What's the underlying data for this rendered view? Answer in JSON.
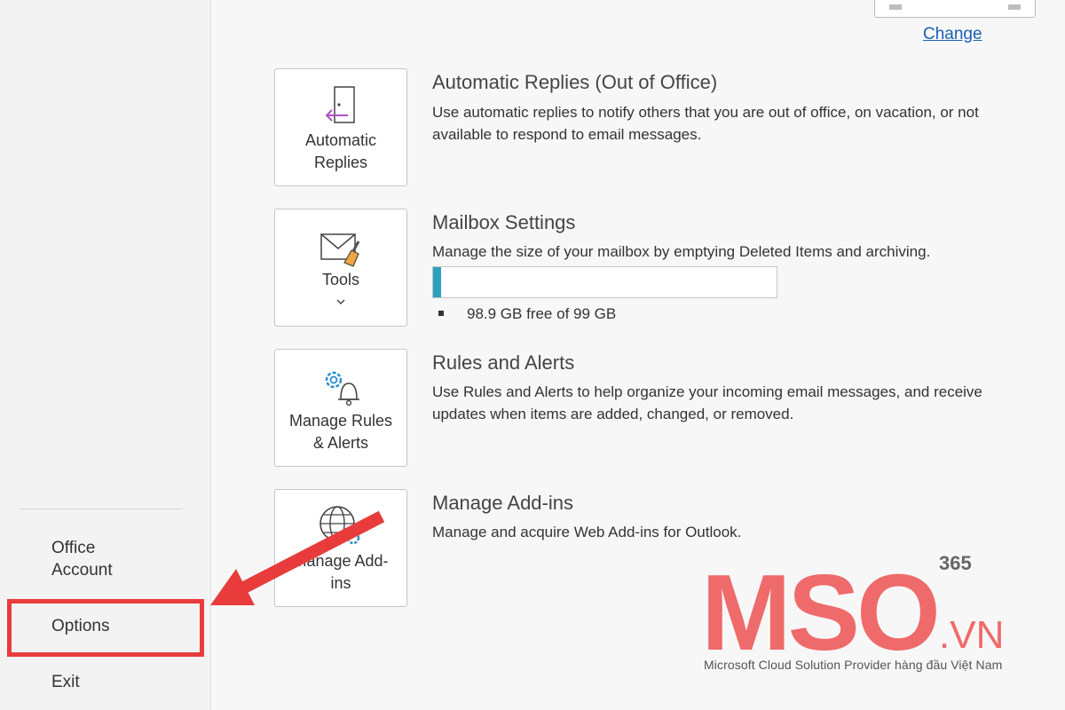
{
  "sidebar": {
    "items": [
      {
        "label": "Office Account"
      },
      {
        "label": "Options"
      },
      {
        "label": "Exit"
      }
    ]
  },
  "account": {
    "change_label": "Change"
  },
  "sections": [
    {
      "tile_label": "Automatic Replies",
      "tile_icon": "door-arrow-icon",
      "title": "Automatic Replies (Out of Office)",
      "description": "Use automatic replies to notify others that you are out of office, on vacation, or not available to respond to email messages."
    },
    {
      "tile_label": "Tools",
      "tile_icon": "mailbox-cleanup-icon",
      "title": "Mailbox Settings",
      "description": "Manage the size of your mailbox by emptying Deleted Items and archiving.",
      "storage_text": "98.9 GB free of 99 GB",
      "usage_fraction": 0.001
    },
    {
      "tile_label": "Manage Rules & Alerts",
      "tile_icon": "gear-bell-icon",
      "title": "Rules and Alerts",
      "description": "Use Rules and Alerts to help organize your incoming email messages, and receive updates when items are added, changed, or removed."
    },
    {
      "tile_label": "Manage Add-ins",
      "tile_icon": "globe-gear-icon",
      "title": "Manage Add-ins",
      "description": "Manage and acquire Web Add-ins for Outlook."
    }
  ],
  "watermark": {
    "brand": "MSO",
    "suffix": ".VN",
    "superscript": "365",
    "tagline": "Microsoft Cloud Solution Provider hàng đầu Việt Nam"
  },
  "colors": {
    "accent_red": "#e83c3c",
    "progress_fill": "#2ba0bf",
    "link_blue": "#1a5fb4",
    "logo_pink": "#ef6a6a"
  }
}
